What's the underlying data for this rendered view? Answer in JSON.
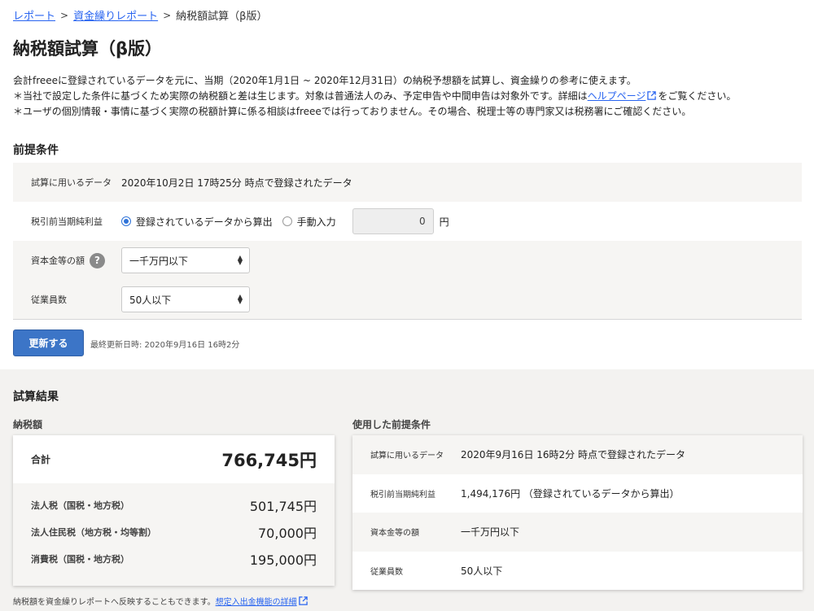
{
  "breadcrumb": {
    "items": [
      "レポート",
      "資金繰りレポート"
    ],
    "current": "納税額試算（β版）",
    "separator": ">"
  },
  "page_title": "納税額試算（β版）",
  "description": {
    "line1": "会計freeeに登録されているデータを元に、当期（2020年1月1日 ~ 2020年12月31日）の納税予想額を試算し、資金繰りの参考に使えます。",
    "line2_before": "＊当社で設定した条件に基づくため実際の納税額と差は生じます。対象は普通法人のみ、予定申告や中間申告は対象外です。詳細は",
    "line2_link": "ヘルプページ",
    "line2_after": "をご覧ください。",
    "line3": "＊ユーザの個別情報・事情に基づく実際の税額計算に係る相談はfreeeでは行っておりません。その場合、税理士等の専門家又は税務署にご確認ください。"
  },
  "conditions": {
    "title": "前提条件",
    "data_label": "試算に用いるデータ",
    "data_value": "2020年10月2日 17時25分 時点で登録されたデータ",
    "income_label": "税引前当期純利益",
    "radio_registered": "登録されているデータから算出",
    "radio_manual": "手動入力",
    "manual_value": "0",
    "unit": "円",
    "capital_label": "資本金等の額",
    "capital_value": "一千万円以下",
    "employees_label": "従業員数",
    "employees_value": "50人以下",
    "help_glyph": "?"
  },
  "update": {
    "button_label": "更新する",
    "last_updated": "最終更新日時: 2020年9月16日 16時2分"
  },
  "results": {
    "title": "試算結果",
    "tax_heading": "納税額",
    "total_label": "合計",
    "total_value": "766,745円",
    "items": [
      {
        "label": "法人税（国税・地方税）",
        "value": "501,745円"
      },
      {
        "label": "法人住民税（地方税・均等割）",
        "value": "70,000円"
      },
      {
        "label": "消費税（国税・地方税）",
        "value": "195,000円"
      }
    ],
    "used_heading": "使用した前提条件",
    "used": [
      {
        "label": "試算に用いるデータ",
        "value": "2020年9月16日 16時2分 時点で登録されたデータ"
      },
      {
        "label": "税引前当期純利益",
        "value": "1,494,176円 （登録されているデータから算出）"
      },
      {
        "label": "資本金等の額",
        "value": "一千万円以下"
      },
      {
        "label": "従業員数",
        "value": "50人以下"
      }
    ]
  },
  "footer": {
    "note": "納税額を資金繰りレポートへ反映することもできます。",
    "link": "想定入出金機能の詳細"
  },
  "colors": {
    "link": "#2864f0",
    "primary_button": "#3c75c7",
    "shade": "#f6f5f3"
  }
}
